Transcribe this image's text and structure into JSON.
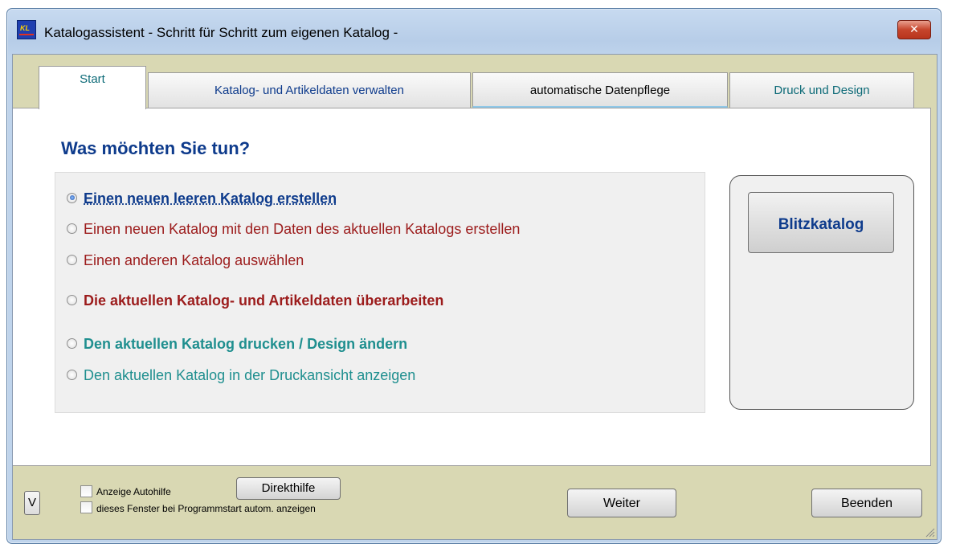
{
  "window": {
    "title": "Katalogassistent  - Schritt für Schritt zum eigenen Katalog -",
    "close_glyph": "✕"
  },
  "tabs": [
    {
      "label": "Start",
      "active": true,
      "color": "#0e6b78"
    },
    {
      "label": "Katalog- und Artikeldaten verwalten",
      "active": false,
      "color": "#0e3b8c"
    },
    {
      "label": "automatische Datenpflege",
      "active": false,
      "color": "#000000"
    },
    {
      "label": "Druck und  Design",
      "active": false,
      "color": "#0e6b78"
    }
  ],
  "main": {
    "heading": "Was möchten Sie tun?",
    "options": [
      {
        "label": "Einen neuen leeren Katalog erstellen",
        "checked": true,
        "bold": true,
        "color": "#0e3b8c"
      },
      {
        "label": "Einen neuen Katalog mit den Daten des aktuellen Katalogs erstellen",
        "checked": false,
        "bold": false,
        "color": "#9c1c1c"
      },
      {
        "label": "Einen anderen Katalog auswählen",
        "checked": false,
        "bold": false,
        "color": "#9c1c1c"
      },
      {
        "label": "Die aktuellen Katalog- und Artikeldaten überarbeiten",
        "checked": false,
        "bold": true,
        "color": "#9c1c1c"
      },
      {
        "label": "Den aktuellen Katalog drucken  /  Design ändern",
        "checked": false,
        "bold": true,
        "color": "#1f8f8f"
      },
      {
        "label": "Den aktuellen Katalog in der Druckansicht anzeigen",
        "checked": false,
        "bold": false,
        "color": "#1f8f8f"
      }
    ],
    "blitz_label": "Blitzkatalog"
  },
  "footer": {
    "v_label": "V",
    "autohilfe_label": "Anzeige Autohilfe",
    "startup_label": "dieses Fenster bei Programmstart  autom. anzeigen",
    "direkthilfe_label": "Direkthilfe",
    "weiter_label": "Weiter",
    "beenden_label": "Beenden"
  },
  "icons": {
    "app": "app-icon",
    "close": "close-icon",
    "resize": "resize-grip-icon"
  }
}
